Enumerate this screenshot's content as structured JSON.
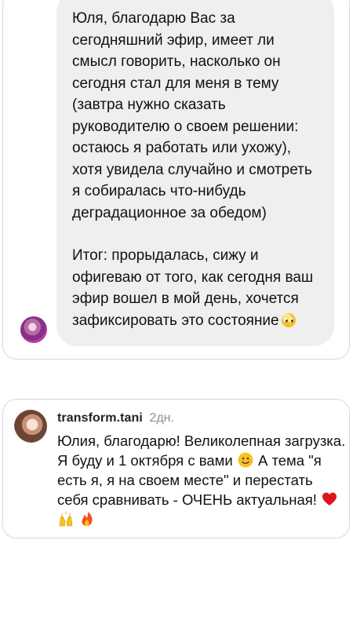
{
  "dm_message": {
    "paragraph_1": "Юля, благодарю Вас за\nсегодняшний эфир, имеет ли\nсмысл говорить, насколько он\nсегодня стал для меня в тему\n(завтра нужно сказать\nруководителю о своем решении:\nостаюсь я работать или ухожу),\nхотя увидела случайно и смотреть\nя собиралась что-нибудь\nдеградационное за обедом)",
    "paragraph_2": "Итог: прорыдалась, сижу и\nофигеваю от того, как сегодня ваш\nэфир вошел в мой день, хочется\nзафиксировать это состояние",
    "emoji": "pleading-face-icon"
  },
  "comment": {
    "username": "transform.tani",
    "time": "2дн.",
    "text_1": "Юлия, благодарю! Великолепная загрузка. Я буду и 1 октября с вами",
    "text_2": "А тема \"я есть я, я на своем месте\" и перестать себя сравнивать - ОЧЕНЬ актуальная!",
    "emojis": [
      "smiling-face-icon",
      "red-heart-icon",
      "raising-hands-icon",
      "fire-icon"
    ]
  }
}
